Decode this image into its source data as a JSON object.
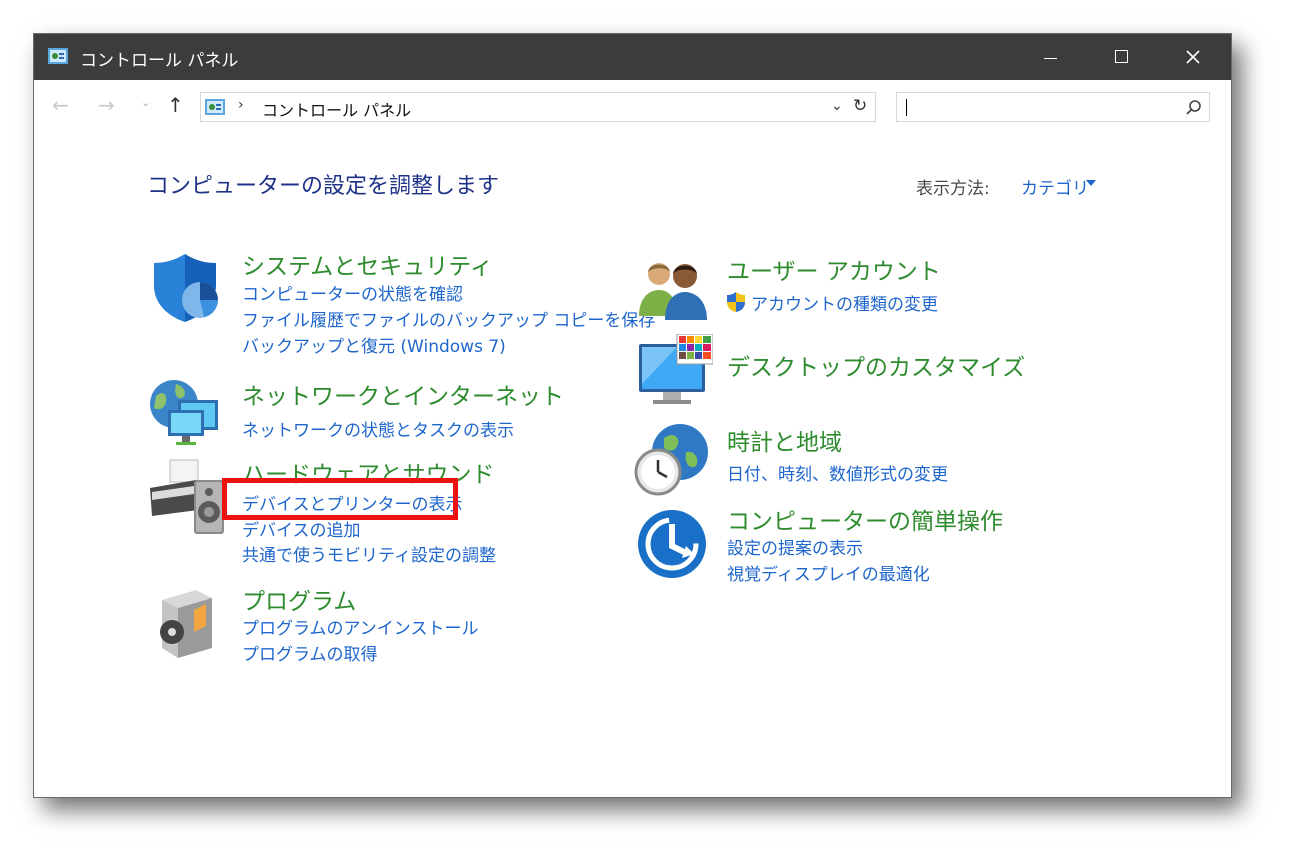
{
  "window": {
    "title": "コントロール パネル"
  },
  "address": {
    "separator": "›",
    "path": "コントロール パネル",
    "search_placeholder": ""
  },
  "main": {
    "heading": "コンピューターの設定を調整します",
    "view_by_label": "表示方法:",
    "view_by_value": "カテゴリ"
  },
  "categories": {
    "system_security": {
      "title": "システムとセキュリティ",
      "links": [
        "コンピューターの状態を確認",
        "ファイル履歴でファイルのバックアップ コピーを保存",
        "バックアップと復元 (Windows 7)"
      ]
    },
    "network": {
      "title": "ネットワークとインターネット",
      "links": [
        "ネットワークの状態とタスクの表示"
      ]
    },
    "hardware_sound": {
      "title": "ハードウェアとサウンド",
      "links": [
        "デバイスとプリンターの表示",
        "デバイスの追加",
        "共通で使うモビリティ設定の調整"
      ]
    },
    "programs": {
      "title": "プログラム",
      "links": [
        "プログラムのアンインストール",
        "プログラムの取得"
      ]
    },
    "user_accounts": {
      "title": "ユーザー アカウント",
      "links": [
        "アカウントの種類の変更"
      ]
    },
    "desktop": {
      "title": "デスクトップのカスタマイズ",
      "links": []
    },
    "clock_region": {
      "title": "時計と地域",
      "links": [
        "日付、時刻、数値形式の変更"
      ]
    },
    "ease_of_access": {
      "title": "コンピューターの簡単操作",
      "links": [
        "設定の提案の表示",
        "視覚ディスプレイの最適化"
      ]
    }
  },
  "colors": {
    "titlebar": "#3c3c3c",
    "heading": "#1e3287",
    "category_title": "#2e8b2e",
    "link": "#1e66cc",
    "highlight": "#ee1111"
  }
}
